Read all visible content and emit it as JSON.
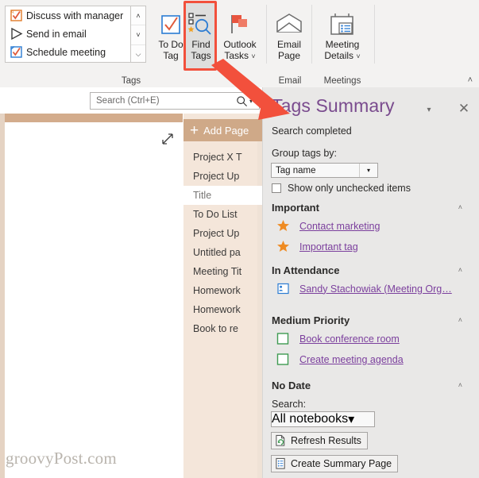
{
  "ribbon": {
    "tag_gallery": {
      "items": [
        {
          "label": "Discuss with manager",
          "icon": "tag-discuss-icon"
        },
        {
          "label": "Send in email",
          "icon": "tag-send-email-icon"
        },
        {
          "label": "Schedule meeting",
          "icon": "tag-schedule-meeting-icon"
        }
      ],
      "scroll_up": "˄",
      "scroll_down": "˅",
      "more": "⌵"
    },
    "buttons": [
      {
        "name": "to-do-tag",
        "line1": "To Do",
        "line2": "Tag",
        "icon": "checkmark-box-icon",
        "dropdown": false
      },
      {
        "name": "find-tags",
        "line1": "Find",
        "line2": "Tags",
        "icon": "find-tags-icon",
        "dropdown": false
      },
      {
        "name": "outlook-tasks",
        "line1": "Outlook",
        "line2": "Tasks",
        "icon": "flag-icon",
        "dropdown": true
      },
      {
        "name": "email-page",
        "line1": "Email",
        "line2": "Page",
        "icon": "envelope-icon",
        "dropdown": false
      },
      {
        "name": "meeting-details",
        "line1": "Meeting",
        "line2": "Details",
        "icon": "calendar-icon",
        "dropdown": true
      }
    ],
    "groups": [
      {
        "label": "Tags"
      },
      {
        "label": "Email"
      },
      {
        "label": "Meetings"
      }
    ],
    "collapse_icon": "˄",
    "dropdown_caret": "˅"
  },
  "search": {
    "placeholder": "Search (Ctrl+E)",
    "icon": "magnifier-icon",
    "caret": "▾"
  },
  "page_list": {
    "add_page_label": "Add Page",
    "add_page_icon": "plus-icon",
    "items": [
      {
        "label": "Project X T",
        "selected": false
      },
      {
        "label": "Project Up",
        "selected": false
      },
      {
        "label": "Title",
        "selected": true
      },
      {
        "label": "To Do List",
        "selected": false
      },
      {
        "label": "Project Up",
        "selected": false
      },
      {
        "label": "Untitled pa",
        "selected": false
      },
      {
        "label": "Meeting Tit",
        "selected": false
      },
      {
        "label": "Homework",
        "selected": false
      },
      {
        "label": "Homework",
        "selected": false
      },
      {
        "label": "Book to re",
        "selected": false
      }
    ]
  },
  "canvas": {
    "expand_icon": "expand-arrows-icon",
    "watermark": "groovyPost.com"
  },
  "panel": {
    "title": "Tags Summary",
    "caret_icon": "▾",
    "close_icon": "✕",
    "status": "Search completed",
    "group_label": "Group tags by:",
    "group_value": "Tag name",
    "group_arrow": "▾",
    "unchecked_label": "Show only unchecked items",
    "unchecked_checked": false,
    "sections": [
      {
        "title": "Important",
        "collapse": "˄",
        "items": [
          {
            "label": "Contact marketing",
            "icon": "star-icon"
          },
          {
            "label": "Important tag",
            "icon": "star-icon"
          }
        ]
      },
      {
        "title": "In Attendance",
        "collapse": "˄",
        "items": [
          {
            "label": "Sandy Stachowiak (Meeting Org…",
            "icon": "contact-icon"
          }
        ]
      },
      {
        "title": "Medium Priority",
        "collapse": "˄",
        "items": [
          {
            "label": "Book conference room",
            "icon": "checkbox-green-icon"
          },
          {
            "label": "Create meeting agenda",
            "icon": "checkbox-green-icon"
          }
        ]
      },
      {
        "title": "No Date",
        "collapse": "˄",
        "items": []
      }
    ],
    "search_label": "Search:",
    "notebook_value": "All notebooks",
    "notebook_arrow": "▾",
    "refresh_label": "Refresh Results",
    "refresh_icon": "refresh-page-icon",
    "create_summary_label": "Create Summary Page",
    "create_summary_icon": "summary-page-icon"
  },
  "annotation": {
    "highlight_color": "#f2503c",
    "arrow_color": "#f2503c",
    "target": "find-tags"
  },
  "colors": {
    "accent_purple": "#7a4b8e",
    "link_purple": "#7b3f9d",
    "tan_bar": "#d3ac8c",
    "page_list_bg": "#f4e6da",
    "panel_bg": "#e9e8e7"
  }
}
